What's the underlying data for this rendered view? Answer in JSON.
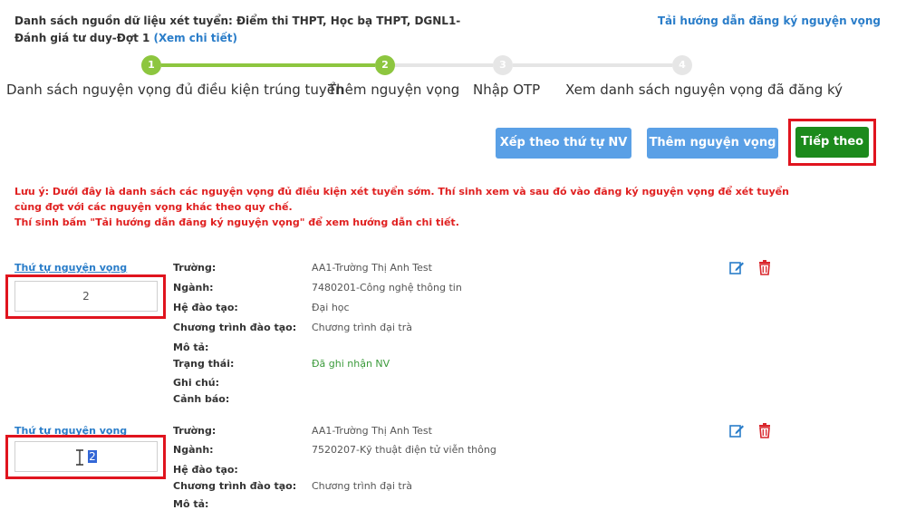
{
  "header": {
    "info_text": "Danh sách nguồn dữ liệu xét tuyển: Điểm thi THPT, Học bạ THPT, DGNL1-Đánh giá tư duy-Đợt 1",
    "details_link": "(Xem chi tiết)",
    "guide_link": "Tải hướng dẫn đăng ký nguyện vọng"
  },
  "stepper": {
    "steps": [
      {
        "number": "1",
        "label": "Danh sách nguyện vọng đủ điều kiện trúng tuyển",
        "state": "done"
      },
      {
        "number": "2",
        "label": "Thêm nguyện vọng",
        "state": "current"
      },
      {
        "number": "3",
        "label": "Nhập OTP",
        "state": "pending"
      },
      {
        "number": "4",
        "label": "Xem danh sách nguyện vọng đã đăng ký",
        "state": "pending"
      }
    ],
    "colors": {
      "done": "#8dc63f",
      "pending": "#e6e6e6"
    }
  },
  "toolbar": {
    "sort_button": "Xếp theo thứ tự NV",
    "add_button": "Thêm nguyện vọng",
    "next_button": "Tiếp theo"
  },
  "notice": {
    "line1": "Lưu ý: Dưới đây là danh sách các nguyện vọng đủ điều kiện xét tuyển sớm. Thí sinh xem và sau đó vào đăng ký nguyện vọng để xét tuyển cùng đợt với các nguyện vọng khác theo quy chế.",
    "line2": "Thí sinh bấm \"Tải hướng dẫn đăng ký nguyện vọng\" để xem hướng dẫn chi tiết."
  },
  "labels": {
    "order": "Thứ tự nguyện vọng",
    "school": "Trường:",
    "major": "Ngành:",
    "system": "Hệ đào tạo:",
    "program": "Chương trình đào tạo:",
    "description": "Mô tả:",
    "status": "Trạng thái:",
    "note": "Ghi chú:",
    "warning": "Cảnh báo:"
  },
  "wishes": [
    {
      "order_value": "2",
      "school": "AA1-Trường Thị Anh Test",
      "major": "7480201-Công nghệ thông tin",
      "system": "Đại học",
      "program": "Chương trình đại trà",
      "description": "",
      "status": "Đã ghi nhận NV",
      "note": "",
      "warning": ""
    },
    {
      "order_value": "2",
      "school": "AA1-Trường Thị Anh Test",
      "major": "7520207-Kỹ thuật điện tử viễn thông",
      "system": "",
      "program": "Chương trình đại trà",
      "description": ""
    }
  ],
  "colors": {
    "accent_blue": "#5aa0e6",
    "link_blue": "#2a7dc9",
    "next_green": "#1c8a1c",
    "highlight_red": "#e0141e",
    "notice_red": "#e02020"
  }
}
